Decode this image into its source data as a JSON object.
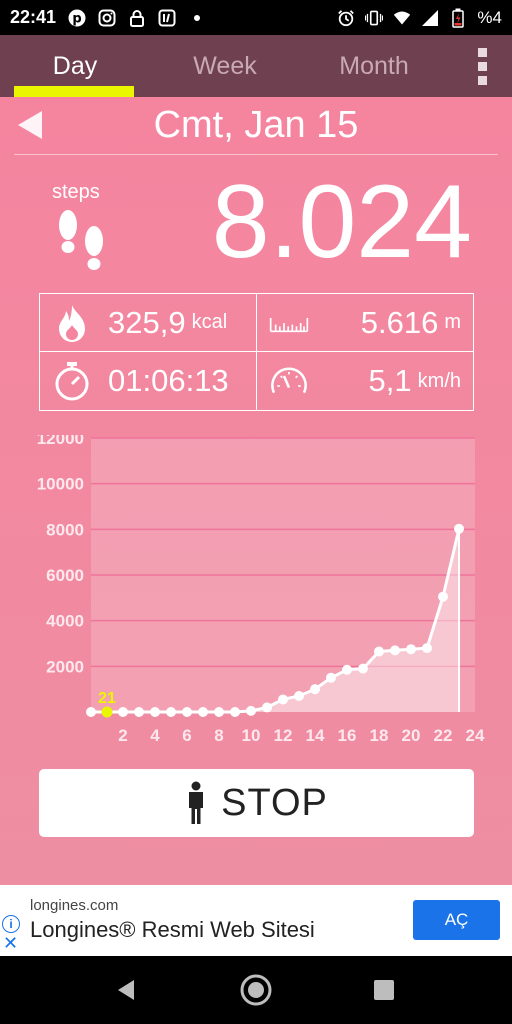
{
  "status_bar": {
    "time": "22:41",
    "icons_left": [
      "pinterest-icon",
      "instagram-icon",
      "lock-icon",
      "app-icon",
      "dot-icon"
    ],
    "icons_right": [
      "alarm-icon",
      "vibrate-icon",
      "wifi-icon",
      "signal-icon",
      "battery-low-icon"
    ],
    "battery_text": "%4"
  },
  "tabs": [
    {
      "label": "Day",
      "active": true
    },
    {
      "label": "Week",
      "active": false
    },
    {
      "label": "Month",
      "active": false
    }
  ],
  "date_title": "Cmt, Jan 15",
  "steps": {
    "label": "steps",
    "value": "8.024"
  },
  "stats": {
    "calories": {
      "value": "325,9",
      "unit": "kcal"
    },
    "distance": {
      "value": "5.616",
      "unit": "m"
    },
    "duration": {
      "value": "01:06:13"
    },
    "speed": {
      "value": "5,1",
      "unit": "km/h"
    }
  },
  "chart_data": {
    "type": "area",
    "y_ticks": [
      "12000",
      "10000",
      "8000",
      "6000",
      "4000",
      "2000"
    ],
    "x_ticks": [
      "2",
      "4",
      "6",
      "8",
      "10",
      "12",
      "14",
      "16",
      "18",
      "20",
      "22",
      "24"
    ],
    "ylim": [
      0,
      12000
    ],
    "xlim": [
      0,
      24
    ],
    "x": [
      0,
      1,
      2,
      3,
      4,
      5,
      6,
      7,
      8,
      9,
      10,
      11,
      12,
      13,
      14,
      15,
      16,
      17,
      18,
      19,
      20,
      21,
      22,
      23
    ],
    "values": [
      0,
      0,
      0,
      0,
      0,
      0,
      0,
      0,
      0,
      0,
      50,
      200,
      550,
      700,
      1000,
      1500,
      1850,
      1900,
      2650,
      2700,
      2750,
      2800,
      5050,
      8024
    ],
    "highlight": {
      "x": 1,
      "label": "21"
    }
  },
  "stop_button": {
    "label": "STOP"
  },
  "ad": {
    "domain": "longines.com",
    "title": "Longines® Resmi Web Sitesi",
    "cta": "AÇ"
  },
  "colors": {
    "tab_bar": "#6f4050",
    "indicator": "#eaf600",
    "background": "#f5849f",
    "highlight": "#eaf600",
    "ad_button": "#1a73e8"
  }
}
